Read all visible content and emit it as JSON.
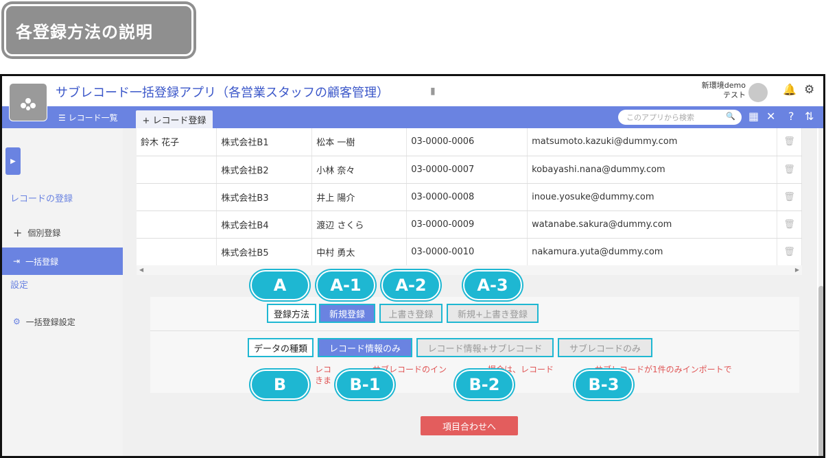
{
  "heading": "各登録方法の説明",
  "app": {
    "title": "サブレコード一括登録アプリ（各営業スタッフの顧客管理）",
    "user_line1": "新環境demo",
    "user_line2": "テスト"
  },
  "nav": {
    "list_label": "☰ レコード一覧",
    "register_label": "+ レコード登録",
    "search_placeholder": "このアプリから検索"
  },
  "sidebar": {
    "section_register": "レコードの登録",
    "item_single": "個別登録",
    "item_bulk": "一括登録",
    "section_settings": "設定",
    "item_bulk_settings": "一括登録設定"
  },
  "table": {
    "rows": [
      {
        "name": "鈴木 花子",
        "company": "株式会社B1",
        "staff": "松本 一樹",
        "phone": "03-0000-0006",
        "email": "matsumoto.kazuki@dummy.com"
      },
      {
        "name": "",
        "company": "株式会社B2",
        "staff": "小林 奈々",
        "phone": "03-0000-0007",
        "email": "kobayashi.nana@dummy.com"
      },
      {
        "name": "",
        "company": "株式会社B3",
        "staff": "井上 陽介",
        "phone": "03-0000-0008",
        "email": "inoue.yosuke@dummy.com"
      },
      {
        "name": "",
        "company": "株式会社B4",
        "staff": "渡辺 さくら",
        "phone": "03-0000-0009",
        "email": "watanabe.sakura@dummy.com"
      },
      {
        "name": "",
        "company": "株式会社B5",
        "staff": "中村 勇太",
        "phone": "03-0000-0010",
        "email": "nakamura.yuta@dummy.com"
      }
    ]
  },
  "register": {
    "method_label": "登録方法",
    "method_new": "新規登録",
    "method_overwrite": "上書き登録",
    "method_both": "新規+上書き登録",
    "type_label": "データの種類",
    "type_record_only": "レコード情報のみ",
    "type_record_sub": "レコード情報+サブレコード",
    "type_sub_only": "サブレコードのみ",
    "notice_line1": "レコ　　　　　サブレコードのイン　　　　　場合は、レコード　　　　　サブレコードが1件のみインポートで",
    "notice_line2": "きま",
    "next_button": "項目合わせへ"
  },
  "callouts": {
    "a": "A",
    "a1": "A-1",
    "a2": "A-2",
    "a3": "A-3",
    "b": "B",
    "b1": "B-1",
    "b2": "B-2",
    "b3": "B-3"
  },
  "colors": {
    "accent": "#6a83e1",
    "callout": "#1eb7d2",
    "danger": "#e35d5d"
  }
}
